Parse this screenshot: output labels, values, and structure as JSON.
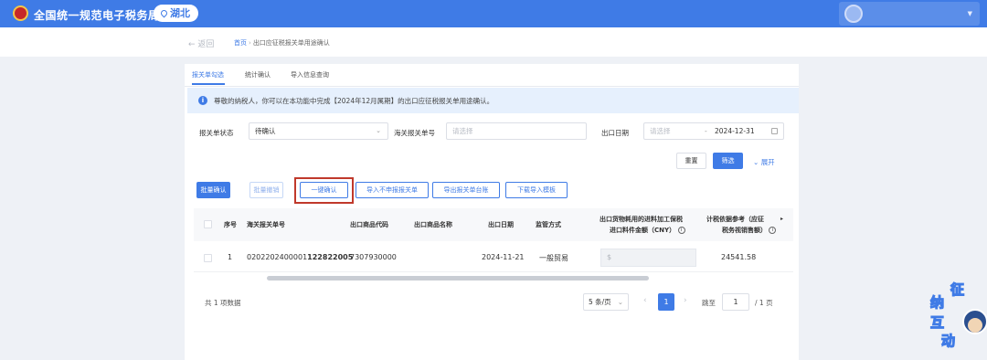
{
  "header": {
    "app_title": "全国统一规范电子税务局",
    "region": "湖北"
  },
  "breadcrumb": {
    "back": "返回",
    "home": "首页",
    "current": "出口应征税报关单用途确认"
  },
  "tabs": [
    {
      "label": "报关单勾选",
      "active": true
    },
    {
      "label": "统计确认",
      "active": false
    },
    {
      "label": "导入信息查询",
      "active": false
    }
  ],
  "notice": "尊敬的纳税人，你可以在本功能中完成【2024年12月属期】的出口应征税报关单用途确认。",
  "filters": {
    "status_label": "报关单状态",
    "status_value": "待确认",
    "customs_no_label": "海关报关单号",
    "customs_no_placeholder": "请选择",
    "export_date_label": "出口日期",
    "date_start_placeholder": "请选择",
    "date_separator": "-",
    "date_end": "2024-12-31",
    "reset": "重置",
    "search": "筛选",
    "expand": "展开"
  },
  "actions": {
    "batch_confirm": "批量确认",
    "batch_cancel": "批量撤销",
    "one_click_confirm": "一键确认",
    "import_no_form": "导入不申报报关单",
    "export_ledger": "导出报关单台账",
    "download_template": "下载导入模板"
  },
  "table": {
    "headers": {
      "index": "序号",
      "customs_no": "海关报关单号",
      "goods_code": "出口商品代码",
      "goods_name": "出口商品名称",
      "export_date": "出口日期",
      "supervision": "监管方式",
      "material_amount_1": "出口货物耗用的进料加工保税",
      "material_amount_2": "进口料件金额（CNY）",
      "tax_basis_1": "计税依据参考（应征",
      "tax_basis_2": "税务视销售额）"
    },
    "rows": [
      {
        "index": "1",
        "customs_no_prefix": "0202202400001",
        "customs_no_bold": "122822005",
        "goods_code": "7307930000",
        "goods_name": "",
        "export_date": "2024-11-21",
        "supervision": "一般贸易",
        "material_amount": "$",
        "tax_basis": "24541.58"
      }
    ]
  },
  "pagination": {
    "total": "共 1 项数据",
    "page_size": "5 条/页",
    "current_page": "1",
    "goto_label": "跳至",
    "goto_value": "1",
    "total_pages": "/ 1 页"
  },
  "watermark": {
    "chars": [
      "征",
      "纳",
      "互",
      "动"
    ]
  },
  "colors": {
    "primary": "#3f7be6",
    "highlight_box": "#c0392b",
    "notice_bg": "#e6f0fd"
  }
}
